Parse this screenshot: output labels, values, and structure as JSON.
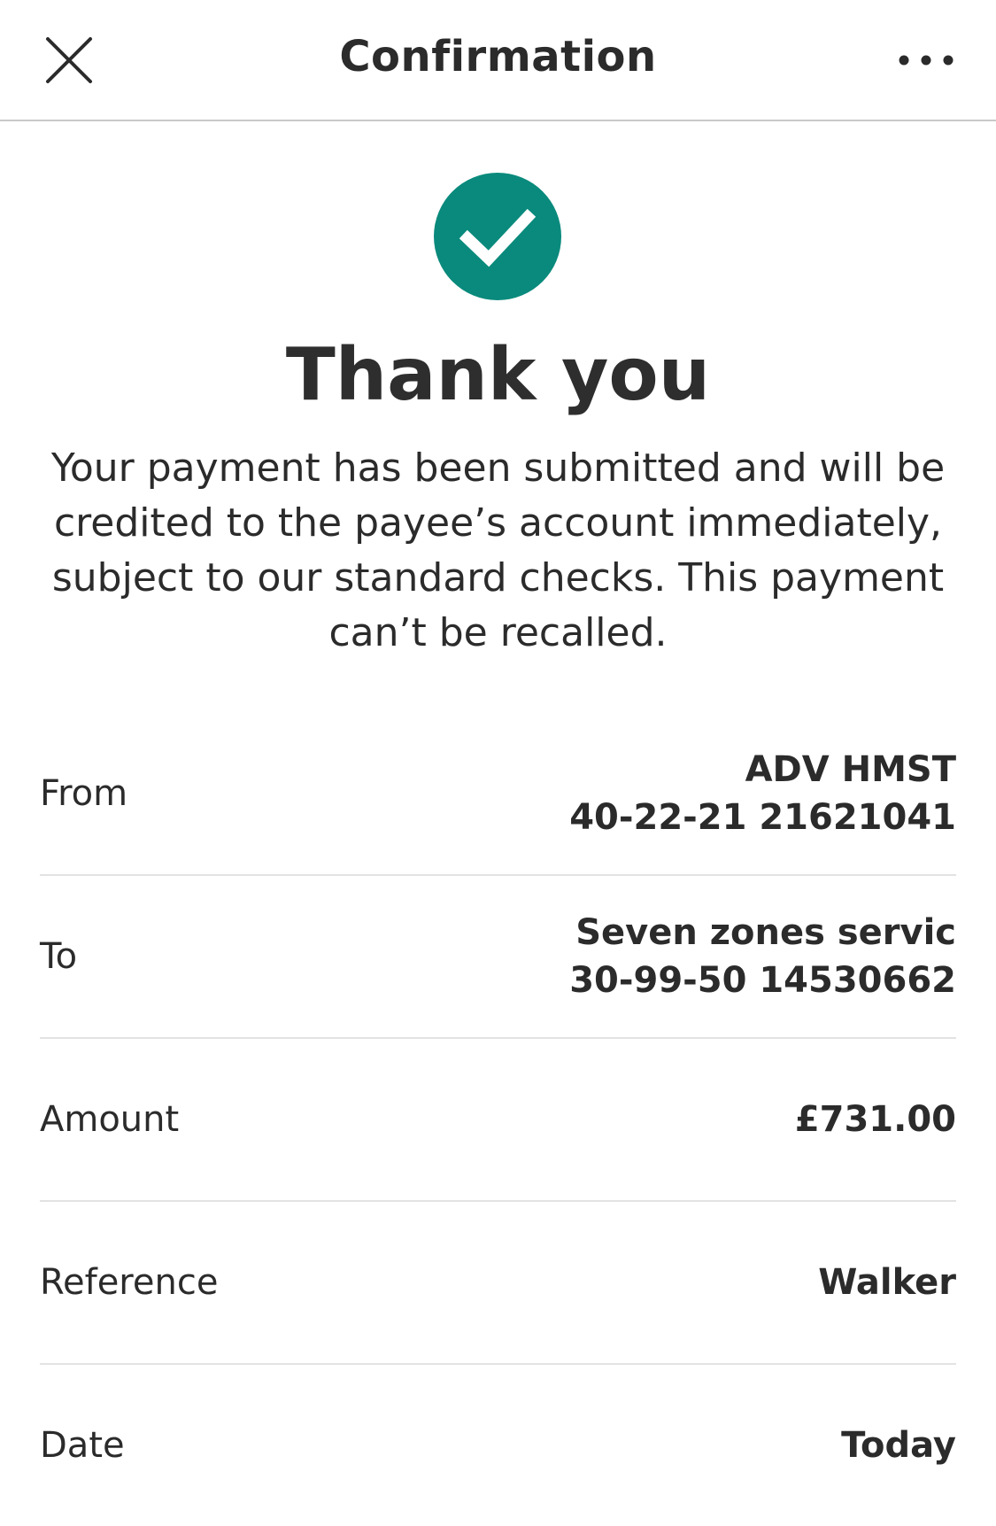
{
  "header": {
    "title": "Confirmation",
    "close_icon": "close-icon",
    "more_icon": "more-horizontal-icon"
  },
  "status": {
    "icon": "check-circle-icon",
    "color": "#098a7c",
    "heading": "Thank you",
    "message": "Your payment has been submitted and will be credited to the payee’s account immediately, subject to our standard checks. This payment can’t be recalled."
  },
  "details": {
    "from": {
      "label": "From",
      "name": "ADV HMST",
      "account": "40-22-21 21621041"
    },
    "to": {
      "label": "To",
      "name": "Seven zones servic",
      "account": "30-99-50 14530662"
    },
    "amount": {
      "label": "Amount",
      "value": "£731.00"
    },
    "reference": {
      "label": "Reference",
      "value": "Walker"
    },
    "date": {
      "label": "Date",
      "value": "Today"
    }
  }
}
